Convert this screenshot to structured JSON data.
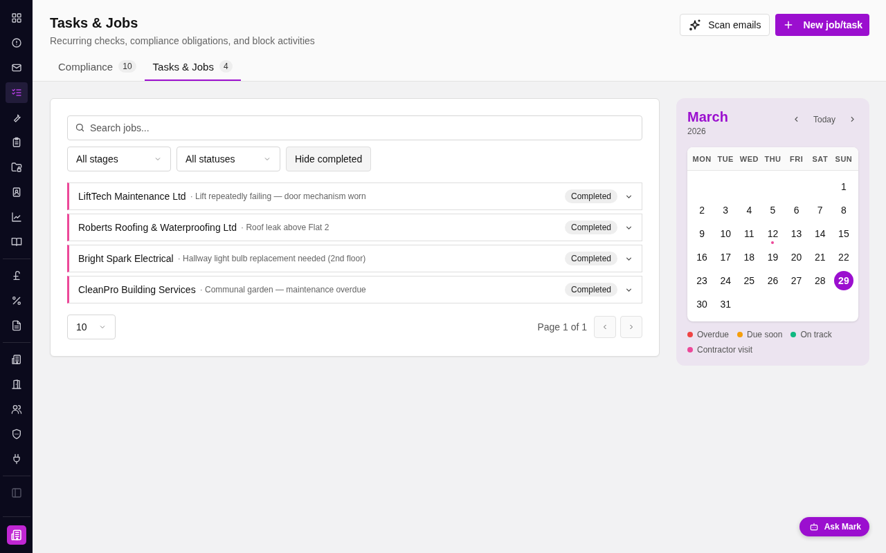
{
  "sidebar": {
    "groups": [
      [
        {
          "selected": false
        },
        {
          "selected": false
        },
        {
          "selected": false
        },
        {
          "selected": true
        },
        {
          "selected": false
        },
        {
          "selected": false
        },
        {
          "selected": false
        },
        {
          "selected": false
        },
        {
          "selected": false
        },
        {
          "selected": false
        }
      ],
      [
        {
          "selected": false
        },
        {
          "selected": false
        },
        {
          "selected": false
        }
      ],
      [
        {
          "selected": false
        },
        {
          "selected": false
        },
        {
          "selected": false
        },
        {
          "selected": false
        },
        {
          "selected": false
        }
      ],
      [
        {
          "selected": false
        }
      ]
    ]
  },
  "header": {
    "title": "Tasks & Jobs",
    "subtitle": "Recurring checks, compliance obligations, and block activities",
    "buttons": [
      {
        "label": "Scan emails",
        "kind": "secondary"
      },
      {
        "label": "New job/task",
        "kind": "primary"
      }
    ]
  },
  "tabs": [
    {
      "label": "Compliance",
      "count": "10",
      "selected": false
    },
    {
      "label": "Tasks & Jobs",
      "count": "4",
      "selected": true
    }
  ],
  "jobs": {
    "search": {
      "placeholder": "Search jobs..."
    },
    "filters": [
      {
        "label": "All stages",
        "kind": "dropdown"
      },
      {
        "label": "All statuses",
        "kind": "dropdown"
      },
      {
        "label": "Hide completed",
        "kind": "toggle"
      }
    ],
    "rows": [
      {
        "name": "LiftTech Maintenance Ltd",
        "description": "· Lift repeatedly failing — door mechanism worn",
        "status": "Completed",
        "expanded": false
      },
      {
        "name": "Roberts Roofing & Waterproofing Ltd",
        "description": "· Roof leak above Flat 2",
        "status": "Completed",
        "expanded": false
      },
      {
        "name": "Bright Spark Electrical",
        "description": "· Hallway light bulb replacement needed (2nd floor)",
        "status": "Completed",
        "expanded": false
      },
      {
        "name": "CleanPro Building Services",
        "description": "· Communal garden — maintenance overdue",
        "status": "Completed",
        "expanded": false
      }
    ],
    "page_size": "10",
    "page_info": "Page 1 of 1"
  },
  "calendar": {
    "month": "March",
    "year": "2026",
    "today_label": "Today",
    "weekdays": [
      "MON",
      "TUE",
      "WED",
      "THU",
      "FRI",
      "SAT",
      "SUN"
    ],
    "weeks": [
      {
        "kind": "leading",
        "days": [
          {
            "day": "1",
            "selected": false
          }
        ]
      },
      {
        "kind": "full",
        "days": [
          {
            "day": "2",
            "selected": false
          },
          {
            "day": "3",
            "selected": false
          },
          {
            "day": "4",
            "selected": false
          },
          {
            "day": "5",
            "selected": false
          },
          {
            "day": "6",
            "selected": false
          },
          {
            "day": "7",
            "selected": false
          },
          {
            "day": "8",
            "selected": false
          }
        ]
      },
      {
        "kind": "full",
        "days": [
          {
            "day": "9",
            "selected": false
          },
          {
            "day": "10",
            "selected": false
          },
          {
            "day": "11",
            "selected": false
          },
          {
            "day": "12",
            "selected": false,
            "color": "#ec4899"
          },
          {
            "day": "13",
            "selected": false
          },
          {
            "day": "14",
            "selected": false
          },
          {
            "day": "15",
            "selected": false
          }
        ]
      },
      {
        "kind": "full",
        "days": [
          {
            "day": "16",
            "selected": false
          },
          {
            "day": "17",
            "selected": false
          },
          {
            "day": "18",
            "selected": false
          },
          {
            "day": "19",
            "selected": false
          },
          {
            "day": "20",
            "selected": false
          },
          {
            "day": "21",
            "selected": false
          },
          {
            "day": "22",
            "selected": false
          }
        ]
      },
      {
        "kind": "full",
        "days": [
          {
            "day": "23",
            "selected": false
          },
          {
            "day": "24",
            "selected": false
          },
          {
            "day": "25",
            "selected": false
          },
          {
            "day": "26",
            "selected": false
          },
          {
            "day": "27",
            "selected": false
          },
          {
            "day": "28",
            "selected": false
          },
          {
            "day": "29",
            "selected": true
          }
        ]
      },
      {
        "kind": "trailing",
        "days": [
          {
            "day": "30",
            "selected": false
          },
          {
            "day": "31",
            "selected": false
          }
        ]
      }
    ],
    "legend": [
      {
        "label": "Overdue",
        "color": "#ef4444"
      },
      {
        "label": "Due soon",
        "color": "#f59e0b"
      },
      {
        "label": "On track",
        "color": "#10b981"
      },
      {
        "label": "Contractor visit",
        "color": "#ec4899"
      }
    ]
  },
  "assistant": {
    "label": "Ask Mark"
  }
}
